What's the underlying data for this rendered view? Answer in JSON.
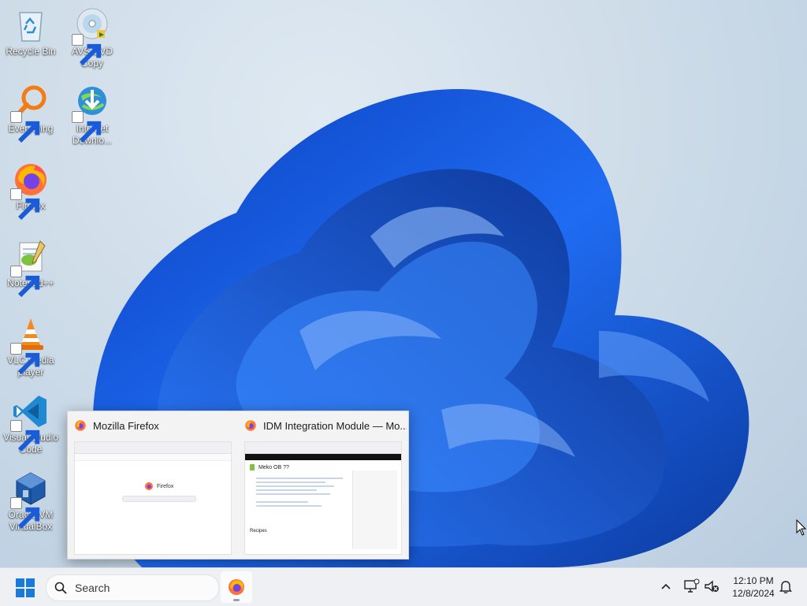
{
  "desktop": {
    "icons": [
      {
        "label": "Recycle Bin",
        "icon": "recycle-bin-icon",
        "shortcut": false
      },
      {
        "label": "AVS DVD\nCopy",
        "icon": "dvd-disc-icon",
        "shortcut": true
      },
      {
        "label": "Everything",
        "icon": "magnifier-icon",
        "shortcut": true
      },
      {
        "label": "Internet\nDownlo...",
        "icon": "internet-download-manager-icon",
        "shortcut": true
      },
      {
        "label": "Firefox",
        "icon": "firefox-icon",
        "shortcut": true
      },
      {
        "label": "Notepad++",
        "icon": "notepad-plus-plus-icon",
        "shortcut": true
      },
      {
        "label": "VLC media\nplayer",
        "icon": "vlc-cone-icon",
        "shortcut": true
      },
      {
        "label": "Visual Studio\nCode",
        "icon": "vscode-icon",
        "shortcut": true
      },
      {
        "label": "Oracle VM\nVirtualBox",
        "icon": "virtualbox-icon",
        "shortcut": true
      }
    ]
  },
  "preview": {
    "windows": [
      {
        "title": "Mozilla Firefox",
        "icon": "firefox-icon",
        "content_label": "Firefox"
      },
      {
        "title": "IDM Integration Module — Mo...",
        "icon": "firefox-icon",
        "content_label": "Meko OB ??",
        "section_label": "Recipes"
      }
    ]
  },
  "taskbar": {
    "search_placeholder": "Search",
    "pinned": [
      {
        "name": "Firefox",
        "icon": "firefox-icon"
      }
    ],
    "tray_icons": [
      "chevron-up-icon",
      "network-icon",
      "volume-muted-icon"
    ],
    "time": "12:10 PM",
    "date": "12/8/2024",
    "notification_icon": "bell-icon"
  },
  "colors": {
    "wallpaper_bloom": "#1a5cd8",
    "wallpaper_bg": "#cfdde9",
    "taskbar_bg": "#eef0f3",
    "firefox_orange": "#ff7139",
    "firefox_purple": "#7542e5"
  }
}
